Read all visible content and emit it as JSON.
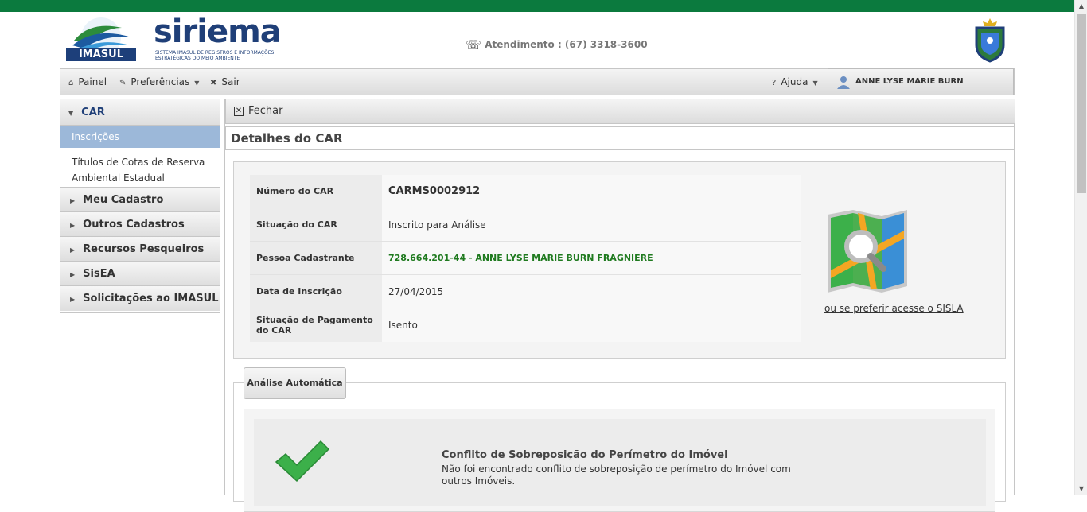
{
  "header": {
    "imasul_label": "IMASUL",
    "siriema_title": "siriema",
    "siriema_subtitle": "SISTEMA IMASUL DE REGISTROS E INFORMAÇÕES ESTRATÉGICAS DO MEIO AMBIENTE",
    "phone_text": "Atendimento : (67) 3318-3600"
  },
  "menubar": {
    "painel": "Painel",
    "preferencias": "Preferências",
    "sair": "Sair",
    "ajuda": "Ajuda",
    "user_name": "ANNE LYSE MARIE BURN FRAGNIERE"
  },
  "sidebar": {
    "car": "CAR",
    "inscricoes": "Inscrições",
    "titulos": "Títulos de Cotas de Reserva Ambiental Estadual",
    "sections": [
      "Meu Cadastro",
      "Outros Cadastros",
      "Recursos Pesqueiros",
      "SisEA",
      "Solicitações ao IMASUL"
    ]
  },
  "content": {
    "fechar": "Fechar",
    "title": "Detalhes do CAR",
    "fields": [
      {
        "label": "Número do CAR",
        "value": "CARMS0002912"
      },
      {
        "label": "Situação do CAR",
        "value": "Inscrito para Análise"
      },
      {
        "label": "Pessoa Cadastrante",
        "value": "728.664.201-44 - ANNE LYSE MARIE BURN FRAGNIERE"
      },
      {
        "label": "Data de Inscrição",
        "value": "27/04/2015"
      },
      {
        "label": "Situação de Pagamento do CAR",
        "value": "Isento"
      }
    ],
    "sisla_link": "ou se preferir acesse o SISLA",
    "analysis_tab": "Análise Automática",
    "conflict_title": "Conflito de Sobreposição do Perímetro do Imóvel",
    "conflict_text": "Não foi encontrado conflito de sobreposição de perímetro do Imóvel com outros Imóveis."
  },
  "colors": {
    "topbar": "#0b7a3e",
    "brand_blue": "#1f3f78",
    "active_item": "#9cb8d9",
    "green_text": "#1f7a1f"
  },
  "icons": [
    "phone-icon",
    "home-icon",
    "pencil-icon",
    "close-icon",
    "help-icon",
    "user-icon",
    "map-search-icon",
    "checkmark-icon"
  ]
}
